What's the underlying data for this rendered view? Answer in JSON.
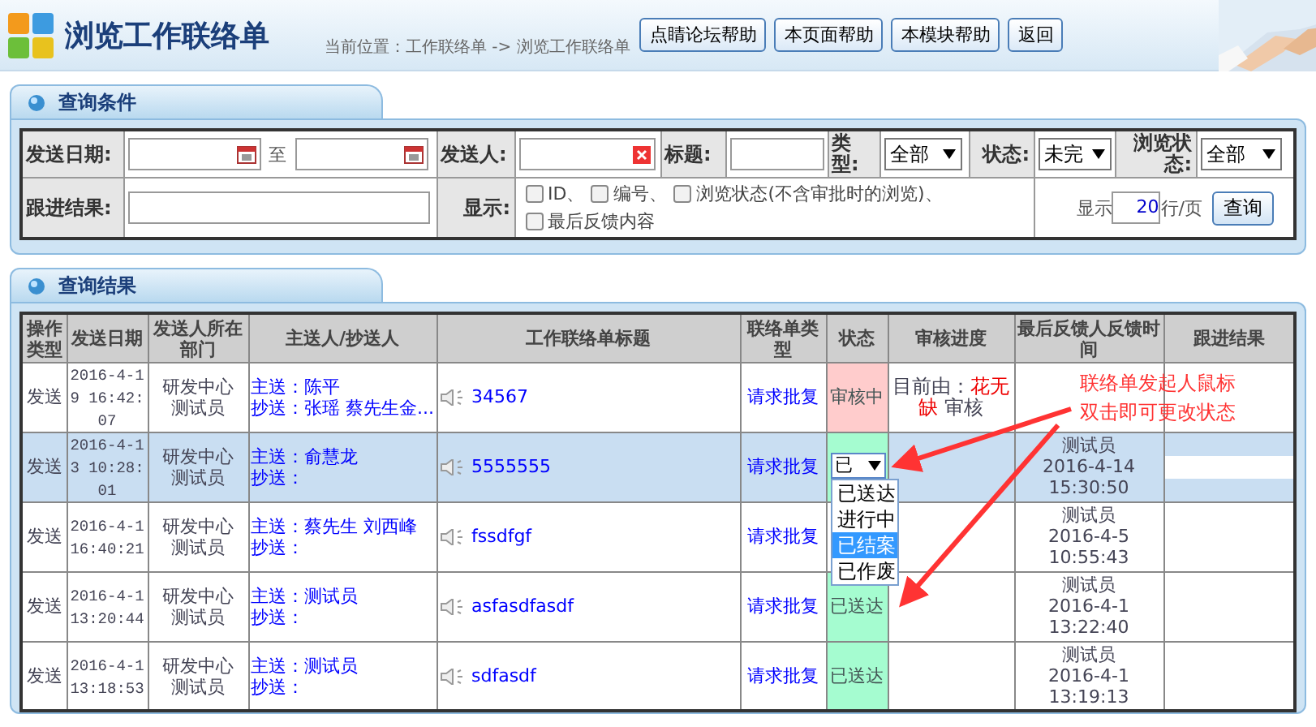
{
  "header": {
    "title": "浏览工作联络单",
    "breadcrumb": "当前位置：工作联络单  ->  浏览工作联络单",
    "buttons": [
      "点睛论坛帮助",
      "本页面帮助",
      "本模块帮助",
      "返回"
    ]
  },
  "query": {
    "title": "查询条件",
    "labels": {
      "send_date": "发送日期:",
      "to": "至",
      "sender": "发送人:",
      "subject": "标题:",
      "type": "类型:",
      "status": "状态:",
      "browse_status": "浏览状态:",
      "follow_up": "跟进结果:",
      "display": "显示:",
      "show": "显示",
      "per_page": "行/页"
    },
    "selects": {
      "type": "全部",
      "status": "未完",
      "browse_status": "全部"
    },
    "checkboxes": [
      {
        "label": "ID、",
        "checked": false
      },
      {
        "label": "编号、",
        "checked": false
      },
      {
        "label": "浏览状态(不含审批时的浏览)、",
        "checked": false
      },
      {
        "label": "最后反馈内容",
        "checked": false
      }
    ],
    "page_size": "20",
    "search_button": "查询"
  },
  "results": {
    "title": "查询结果",
    "columns": [
      "操作类型",
      "发送日期",
      "发送人所在部门",
      "主送人/抄送人",
      "工作联络单标题",
      "联络单类型",
      "状态",
      "审核进度",
      "最后反馈人反馈时间",
      "跟进结果"
    ],
    "rows": [
      {
        "selected": false,
        "op": "发送",
        "date": "2016-4-19 16:42:07",
        "dept": "研发中心测试员",
        "to": "主送：陈平",
        "cc": "抄送：张瑶 蔡先生金...",
        "title": "34567",
        "type": "请求批复",
        "status": {
          "kind": "pending",
          "text": "审核中"
        },
        "progress": {
          "prefix": "目前由：",
          "person": "花无缺",
          "suffix": "审核"
        },
        "note": [
          "联络单发起人鼠标",
          "双击即可更改状态"
        ]
      },
      {
        "selected": true,
        "op": "发送",
        "date": "2016-4-13 10:28:01",
        "dept": "研发中心测试员",
        "to": "主送：俞慧龙",
        "cc": "抄送：",
        "title": "5555555",
        "type": "请求批复",
        "status": {
          "kind": "select",
          "text": "已"
        },
        "feedback": "测试员 2016-4-14 15:30:50",
        "follow_up_field": true
      },
      {
        "selected": false,
        "op": "发送",
        "date": "2016-4-1 16:40:21",
        "dept": "研发中心测试员",
        "to": "主送：蔡先生 刘西峰",
        "cc": "抄送：",
        "title": "fssdfgf",
        "type": "请求批复",
        "status": {
          "kind": "hidden"
        },
        "feedback": "测试员 2016-4-5 10:55:43"
      },
      {
        "selected": false,
        "op": "发送",
        "date": "2016-4-1 13:20:44",
        "dept": "研发中心测试员",
        "to": "主送：测试员",
        "cc": "抄送：",
        "title": "asfasdfasdf",
        "type": "请求批复",
        "status": {
          "kind": "sent",
          "text": "已送达"
        },
        "feedback": "测试员 2016-4-1 13:22:40"
      },
      {
        "selected": false,
        "op": "发送",
        "date": "2016-4-1 13:18:53",
        "dept": "研发中心测试员",
        "to": "主送：测试员",
        "cc": "抄送：",
        "title": "sdfasdf",
        "type": "请求批复",
        "status": {
          "kind": "sent",
          "text": "已送达"
        },
        "feedback": "测试员 2016-4-1 13:19:13"
      }
    ],
    "dropdown": [
      {
        "label": "已送达",
        "selected": false
      },
      {
        "label": "进行中",
        "selected": false
      },
      {
        "label": "已结案",
        "selected": true
      },
      {
        "label": "已作废",
        "selected": false
      }
    ]
  }
}
